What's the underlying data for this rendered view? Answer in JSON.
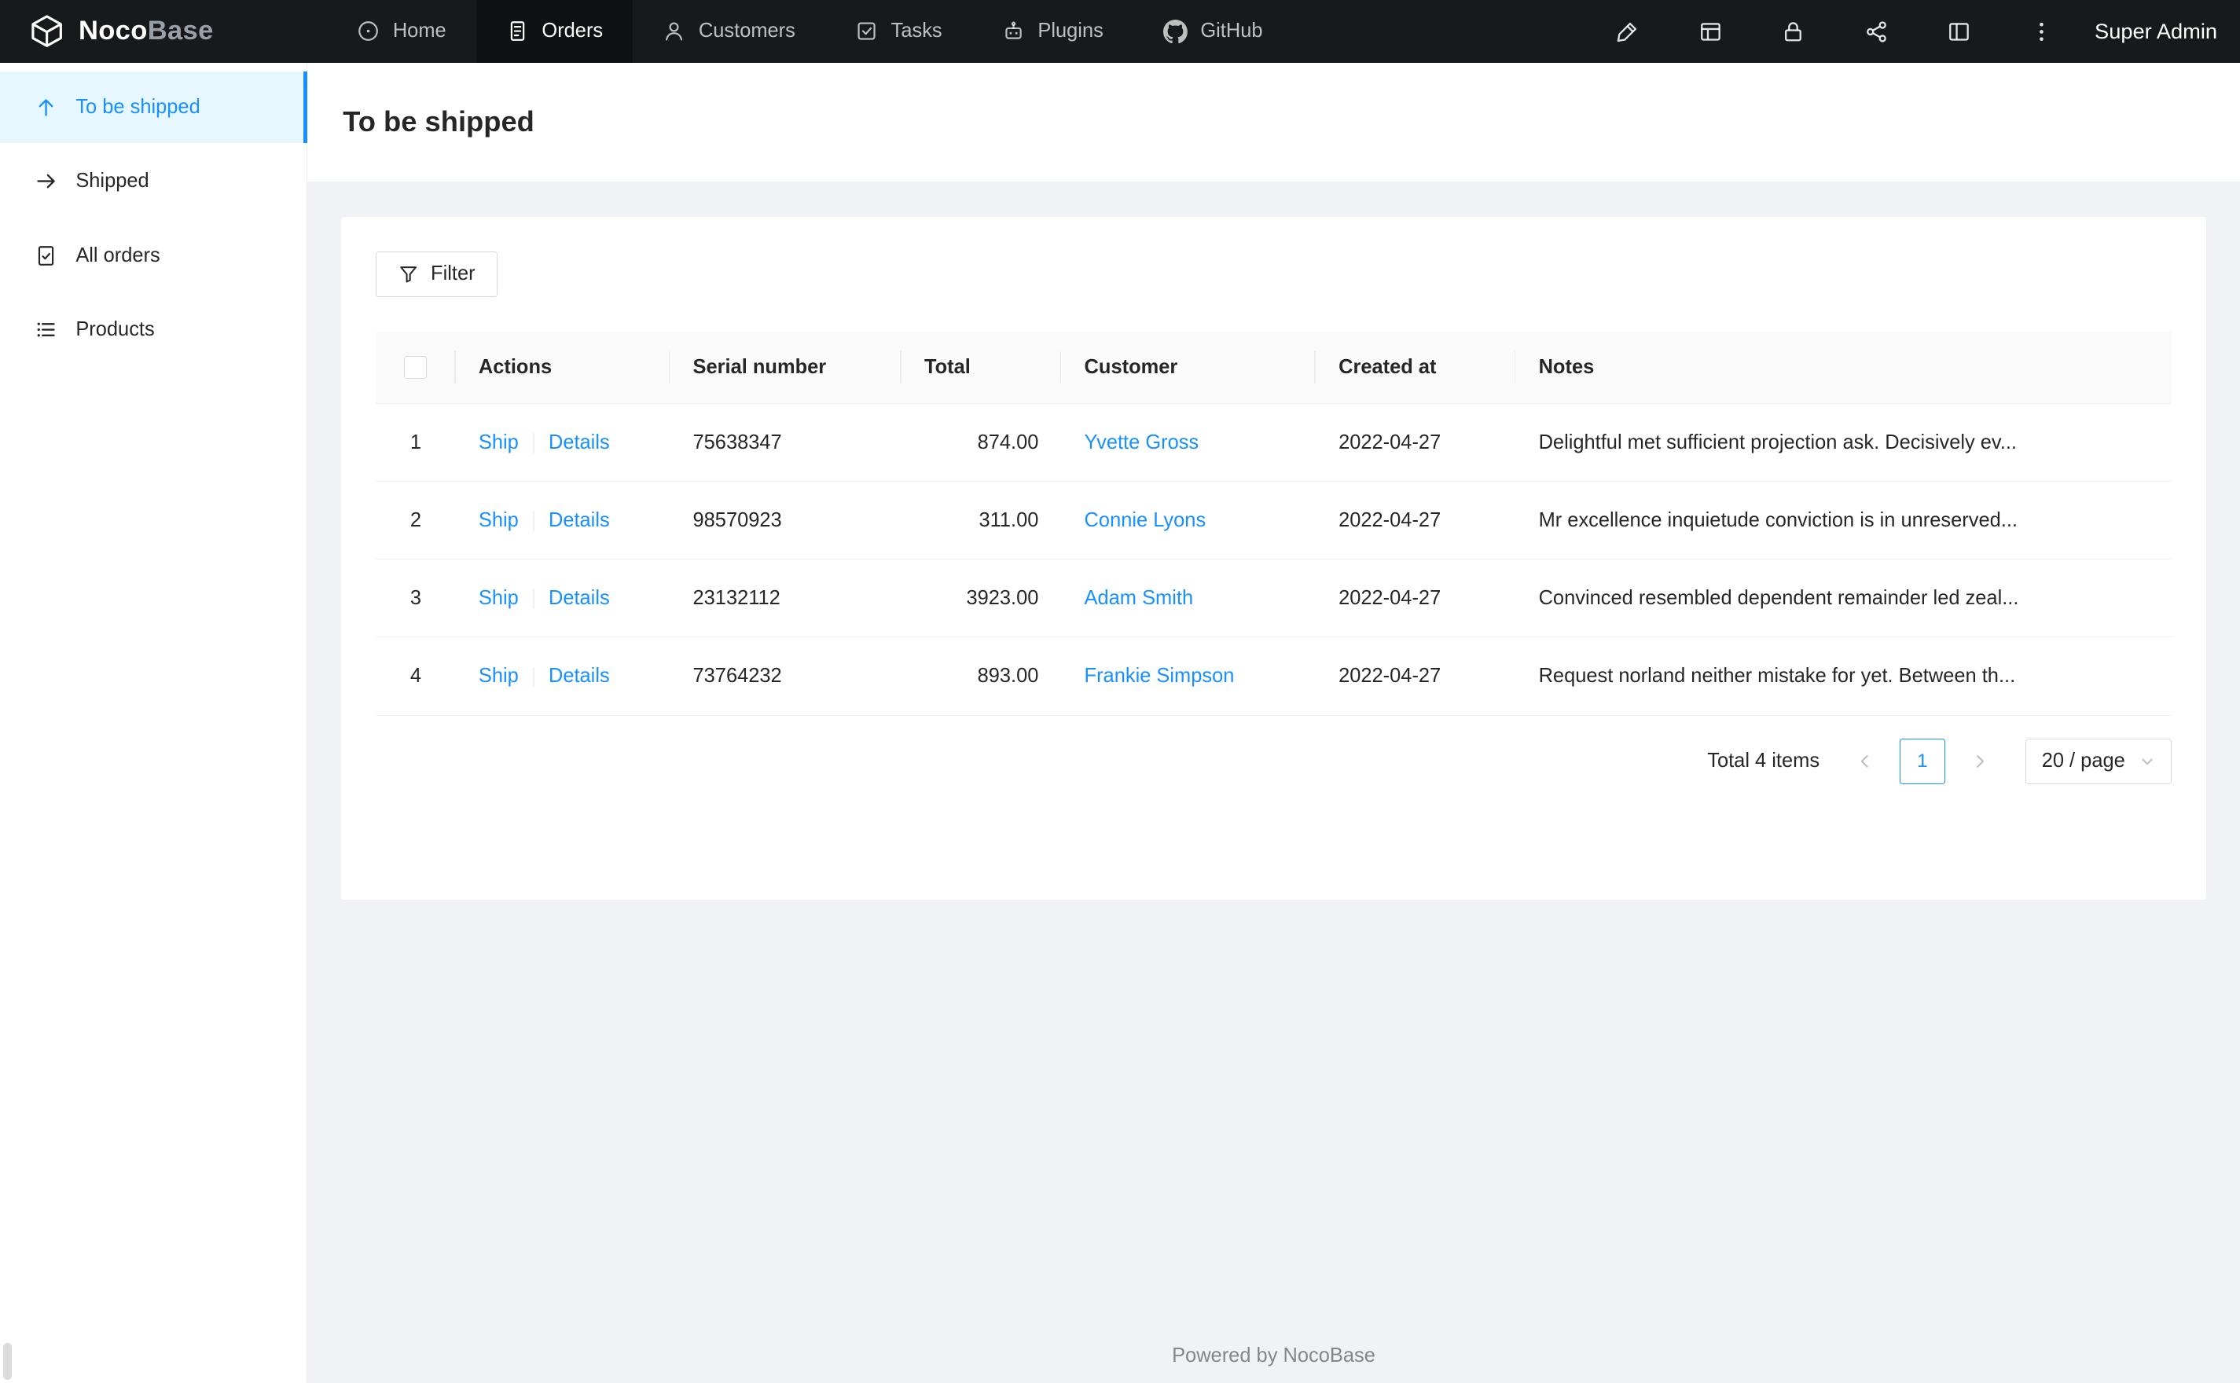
{
  "colors": {
    "accent": "#1890ff",
    "navbar_bg": "#18191c",
    "sidebar_active_bg": "#e6f7ff",
    "content_bg": "#f0f2f5"
  },
  "navbar": {
    "logo_noco": "Noco",
    "logo_base": "Base",
    "items": [
      {
        "label": "Home",
        "icon": "home-icon",
        "active": false
      },
      {
        "label": "Orders",
        "icon": "orders-icon",
        "active": true
      },
      {
        "label": "Customers",
        "icon": "customers-icon",
        "active": false
      },
      {
        "label": "Tasks",
        "icon": "tasks-icon",
        "active": false
      },
      {
        "label": "Plugins",
        "icon": "plugins-icon",
        "active": false
      },
      {
        "label": "GitHub",
        "icon": "github-icon",
        "active": false
      }
    ],
    "right_icons": [
      "highlight-icon",
      "collections-icon",
      "lock-icon",
      "api-icon",
      "layout-icon",
      "more-icon"
    ],
    "user": "Super Admin"
  },
  "sidebar": {
    "items": [
      {
        "label": "To be shipped",
        "icon": "arrow-up-icon",
        "active": true
      },
      {
        "label": "Shipped",
        "icon": "arrow-right-icon",
        "active": false
      },
      {
        "label": "All orders",
        "icon": "document-check-icon",
        "active": false
      },
      {
        "label": "Products",
        "icon": "unordered-list-icon",
        "active": false
      }
    ]
  },
  "page": {
    "title": "To be shipped"
  },
  "toolbar": {
    "filter_label": "Filter"
  },
  "table": {
    "columns": {
      "actions": "Actions",
      "serial": "Serial number",
      "total": "Total",
      "customer": "Customer",
      "created": "Created at",
      "notes": "Notes"
    },
    "rows": [
      {
        "index": "1",
        "ship": "Ship",
        "details": "Details",
        "serial": "75638347",
        "total": "874.00",
        "customer": "Yvette Gross",
        "created": "2022-04-27",
        "notes": "Delightful met sufficient projection ask. Decisively ev..."
      },
      {
        "index": "2",
        "ship": "Ship",
        "details": "Details",
        "serial": "98570923",
        "total": "311.00",
        "customer": "Connie Lyons",
        "created": "2022-04-27",
        "notes": "Mr excellence inquietude conviction is in unreserved..."
      },
      {
        "index": "3",
        "ship": "Ship",
        "details": "Details",
        "serial": "23132112",
        "total": "3923.00",
        "customer": "Adam Smith",
        "created": "2022-04-27",
        "notes": "Convinced resembled dependent remainder led zeal..."
      },
      {
        "index": "4",
        "ship": "Ship",
        "details": "Details",
        "serial": "73764232",
        "total": "893.00",
        "customer": "Frankie Simpson",
        "created": "2022-04-27",
        "notes": "Request norland neither mistake for yet. Between th..."
      }
    ]
  },
  "pagination": {
    "total_text": "Total 4 items",
    "current_page": "1",
    "page_size": "20 / page"
  },
  "footer": {
    "text": "Powered by NocoBase"
  }
}
